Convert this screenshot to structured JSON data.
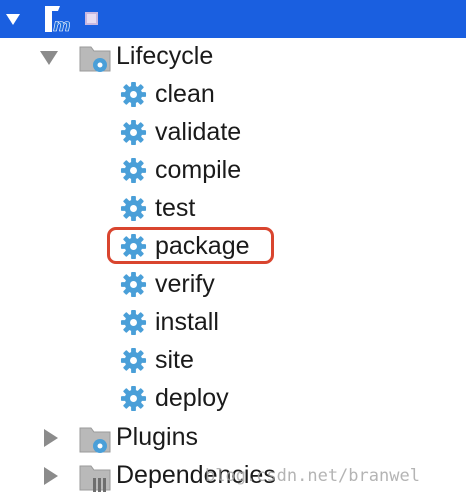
{
  "tree": {
    "lifecycle": {
      "label": "Lifecycle",
      "goals": [
        "clean",
        "validate",
        "compile",
        "test",
        "package",
        "verify",
        "install",
        "site",
        "deploy"
      ],
      "highlighted_goal": "package"
    },
    "plugins": {
      "label": "Plugins"
    },
    "dependencies": {
      "label": "Dependencies"
    }
  },
  "watermark": "blog.csdn.net/branwel",
  "colors": {
    "header_bg": "#1a5fe0",
    "gear": "#4a9fd8",
    "folder": "#b0b0b0",
    "expander": "#8b8b8b",
    "highlight_border": "#d9452f",
    "maven_m": "#1f6fdc",
    "module_square": "#c9b8e0"
  },
  "icons": {
    "project": "maven-project-icon",
    "module": "module-icon",
    "folder": "folder-icon",
    "goal": "gear-icon",
    "plugins_badge": "gear-icon",
    "dependencies_badge": "library-icon"
  }
}
